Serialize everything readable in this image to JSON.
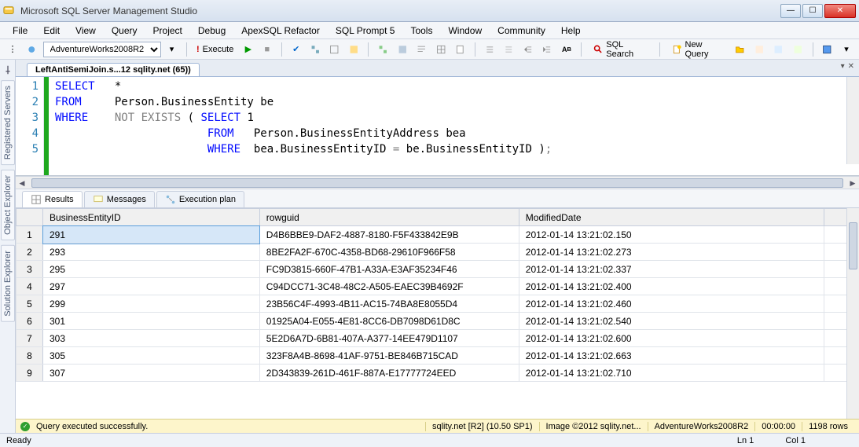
{
  "window": {
    "title": "Microsoft SQL Server Management Studio"
  },
  "menu": {
    "items": [
      "File",
      "Edit",
      "View",
      "Query",
      "Project",
      "Debug",
      "ApexSQL Refactor",
      "SQL Prompt 5",
      "Tools",
      "Window",
      "Community",
      "Help"
    ]
  },
  "toolbar": {
    "database_selected": "AdventureWorks2008R2",
    "execute_label": "Execute",
    "sql_search_label": "SQL Search",
    "new_query_label": "New Query"
  },
  "left_tabs": {
    "registered_servers": "Registered Servers",
    "object_explorer": "Object Explorer",
    "solution_explorer": "Solution Explorer"
  },
  "document_tab": {
    "label": "LeftAntiSemiJoin.s...12 sqlity.net (65))"
  },
  "sql": {
    "line_numbers": [
      "1",
      "2",
      "3",
      "4",
      "5"
    ],
    "line1": {
      "kw": "SELECT",
      "rest": "   *"
    },
    "line2": {
      "kw": "FROM",
      "rest": "     Person.BusinessEntity be"
    },
    "line3": {
      "kw": "WHERE",
      "gray": "    NOT EXISTS",
      "rest": " ( ",
      "kw2": "SELECT",
      "rest2": " 1"
    },
    "line4": {
      "indent": "                       ",
      "kw": "FROM",
      "rest": "   Person.BusinessEntityAddress bea"
    },
    "line5": {
      "indent": "                       ",
      "kw": "WHERE",
      "rest": "  bea.BusinessEntityID ",
      "gray": "=",
      "rest2": " be.BusinessEntityID )",
      "gray2": ";"
    }
  },
  "results_tabs": {
    "results": "Results",
    "messages": "Messages",
    "execution_plan": "Execution plan"
  },
  "results": {
    "columns": [
      "",
      "BusinessEntityID",
      "rowguid",
      "ModifiedDate"
    ],
    "rows": [
      {
        "n": "1",
        "id": "291",
        "guid": "D4B6BBE9-DAF2-4887-8180-F5F433842E9B",
        "date": "2012-01-14 13:21:02.150"
      },
      {
        "n": "2",
        "id": "293",
        "guid": "8BE2FA2F-670C-4358-BD68-29610F966F58",
        "date": "2012-01-14 13:21:02.273"
      },
      {
        "n": "3",
        "id": "295",
        "guid": "FC9D3815-660F-47B1-A33A-E3AF35234F46",
        "date": "2012-01-14 13:21:02.337"
      },
      {
        "n": "4",
        "id": "297",
        "guid": "C94DCC71-3C48-48C2-A505-EAEC39B4692F",
        "date": "2012-01-14 13:21:02.400"
      },
      {
        "n": "5",
        "id": "299",
        "guid": "23B56C4F-4993-4B11-AC15-74BA8E8055D4",
        "date": "2012-01-14 13:21:02.460"
      },
      {
        "n": "6",
        "id": "301",
        "guid": "01925A04-E055-4E81-8CC6-DB7098D61D8C",
        "date": "2012-01-14 13:21:02.540"
      },
      {
        "n": "7",
        "id": "303",
        "guid": "5E2D6A7D-6B81-407A-A377-14EE479D1107",
        "date": "2012-01-14 13:21:02.600"
      },
      {
        "n": "8",
        "id": "305",
        "guid": "323F8A4B-8698-41AF-9751-BE846B715CAD",
        "date": "2012-01-14 13:21:02.663"
      },
      {
        "n": "9",
        "id": "307",
        "guid": "2D343839-261D-461F-887A-E17777724EED",
        "date": "2012-01-14 13:21:02.710"
      }
    ]
  },
  "query_status": {
    "message": "Query executed successfully.",
    "server": "sqlity.net [R2] (10.50 SP1)",
    "image_credit": "Image ©2012 sqlity.net...",
    "database": "AdventureWorks2008R2",
    "elapsed": "00:00:00",
    "rowcount": "1198 rows"
  },
  "statusbar": {
    "ready": "Ready",
    "line": "Ln 1",
    "col": "Col 1"
  }
}
